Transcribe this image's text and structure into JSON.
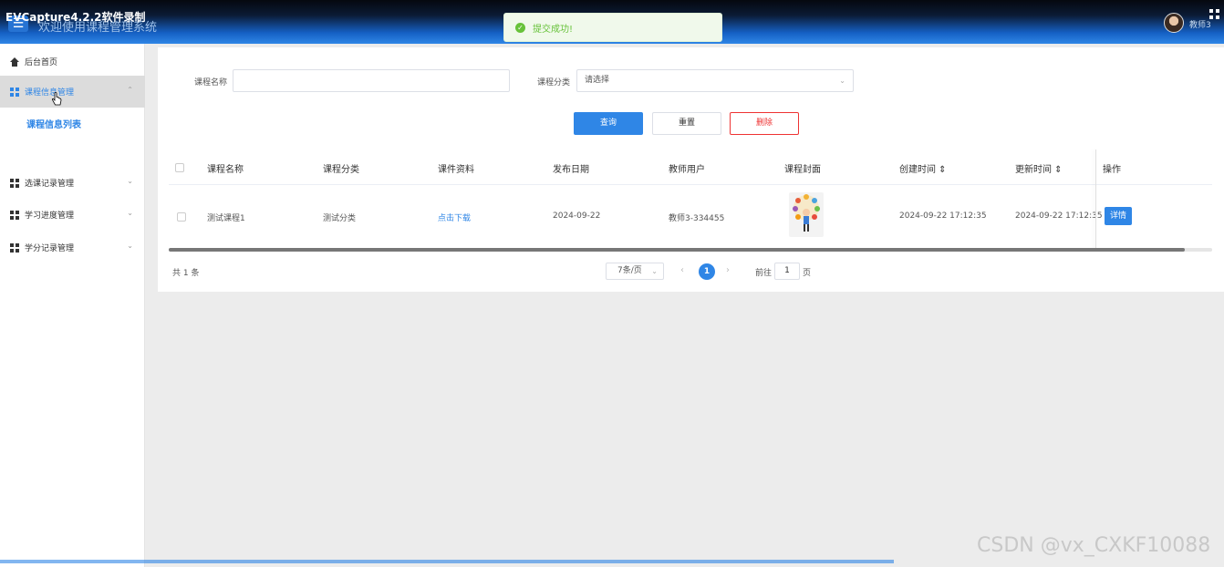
{
  "recorder": {
    "label": "EVCapture4.2.2软件录制"
  },
  "header": {
    "menu_icon": "☰",
    "title": "欢迎使用课程管理系统",
    "user": "教师3",
    "toast": "提交成功!",
    "toast_icon": "check-circle-icon",
    "accent": "#2f86e6"
  },
  "sidebar": {
    "items": [
      {
        "label": "后台首页",
        "icon": "home-icon"
      },
      {
        "label": "课程信息管理",
        "icon": "grid-icon",
        "chevron": "⌃"
      },
      {
        "label": "选课记录管理",
        "icon": "grid-icon",
        "chevron": "⌄"
      },
      {
        "label": "学习进度管理",
        "icon": "grid-icon",
        "chevron": "⌄"
      },
      {
        "label": "学分记录管理",
        "icon": "grid-icon",
        "chevron": "⌄"
      }
    ],
    "sub_item": "课程信息列表"
  },
  "search": {
    "name_label": "课程名称",
    "name_value": "",
    "category_label": "课程分类",
    "category_placeholder": "请选择",
    "query_label": "查询",
    "reset_label": "重置",
    "delete_label": "删除"
  },
  "table": {
    "columns": [
      "课程名称",
      "课程分类",
      "课件资料",
      "发布日期",
      "教师用户",
      "课程封面",
      "创建时间 ⇕",
      "更新时间 ⇕",
      "操作"
    ],
    "rows": [
      {
        "name": "测试课程1",
        "category": "测试分类",
        "material": "点击下载",
        "publish_date": "2024-09-22",
        "teacher": "教师3-334455",
        "created": "2024-09-22 17:12:35",
        "updated": "2024-09-22 17:12:35",
        "action": "详情"
      }
    ]
  },
  "pagination": {
    "total": "共 1 条",
    "page_size": "7条/页",
    "prev": "‹",
    "next": "›",
    "current": "1",
    "goto_prefix": "前往",
    "goto_value": "1",
    "goto_suffix": "页"
  },
  "watermark": "CSDN @vx_CXKF10088"
}
